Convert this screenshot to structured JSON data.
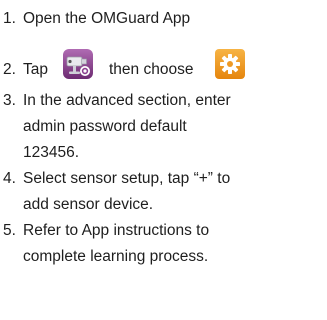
{
  "steps": [
    {
      "number": "1.",
      "lines": [
        "Open the OMGuard App"
      ]
    },
    {
      "number": "2.",
      "before_icon": "Tap",
      "icon_1": "camera-settings-icon",
      "middle": "then choose",
      "icon_2": "gear-settings-icon"
    },
    {
      "number": "3.",
      "lines": [
        "In the advanced section, enter",
        "admin password default",
        "123456."
      ]
    },
    {
      "number": "4.",
      "lines": [
        "Select sensor setup, tap “+” to",
        "add sensor device."
      ]
    },
    {
      "number": "5.",
      "lines": [
        "Refer to App instructions to",
        "complete learning process."
      ]
    }
  ],
  "colors": {
    "camera_icon_bg": "#8a3d8f",
    "gear_icon_bg": "#f29b1d",
    "text": "#1e1e1e"
  }
}
